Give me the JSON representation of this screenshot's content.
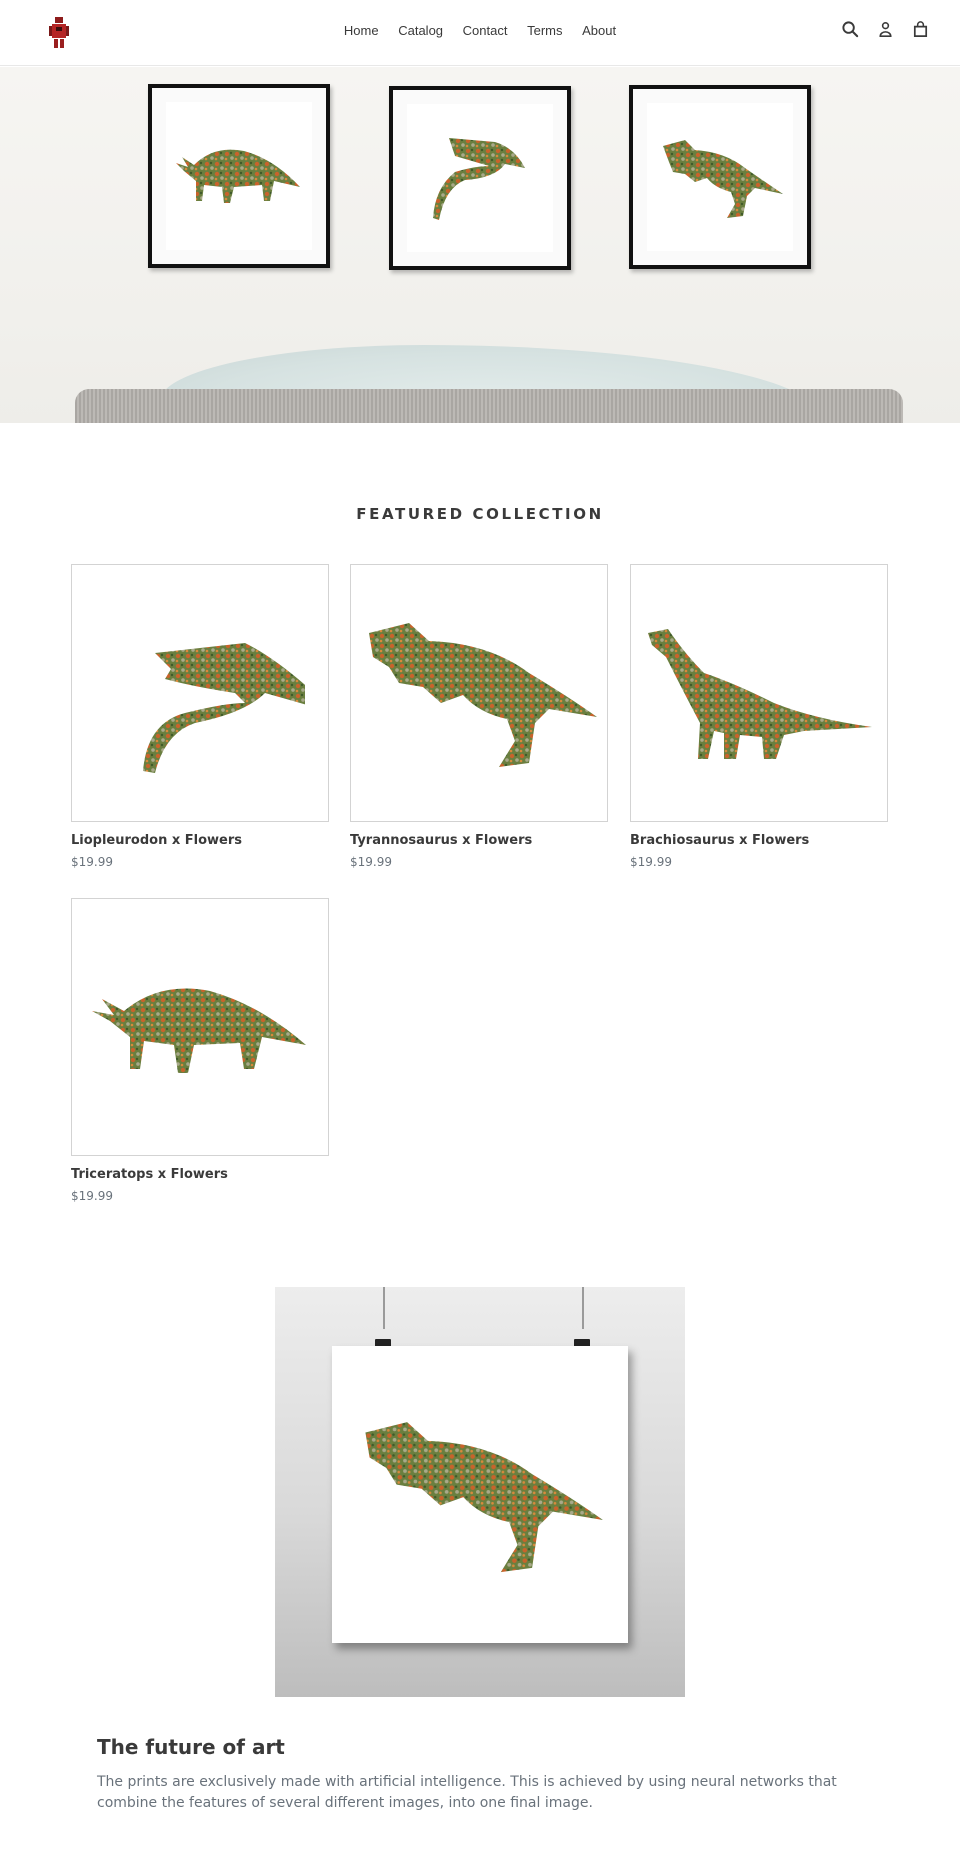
{
  "header": {
    "logo_alt": "Store logo",
    "nav": [
      "Home",
      "Catalog",
      "Contact",
      "Terms",
      "About"
    ],
    "icons": [
      "search-icon",
      "account-icon",
      "cart-icon"
    ]
  },
  "hero": {
    "alt": "Three framed dinosaur flower prints above a sofa"
  },
  "featured": {
    "title": "FEATURED COLLECTION",
    "products": [
      {
        "title": "Liopleurodon x Flowers",
        "price": "$19.99"
      },
      {
        "title": "Tyrannosaurus x Flowers",
        "price": "$19.99"
      },
      {
        "title": "Brachiosaurus x Flowers",
        "price": "$19.99"
      },
      {
        "title": "Triceratops x Flowers",
        "price": "$19.99"
      }
    ]
  },
  "image_with_text": {
    "heading": "The future of art",
    "text": "The prints are exclusively made with artificial intelligence. This is achieved by using neural networks that combine the features of several different images, into one final image."
  },
  "colors": {
    "text": "#3a3a3a",
    "muted": "#69727b",
    "border": "#d3d3d3",
    "flora_green": "#5f7a3a",
    "flora_orange": "#c8632b"
  }
}
